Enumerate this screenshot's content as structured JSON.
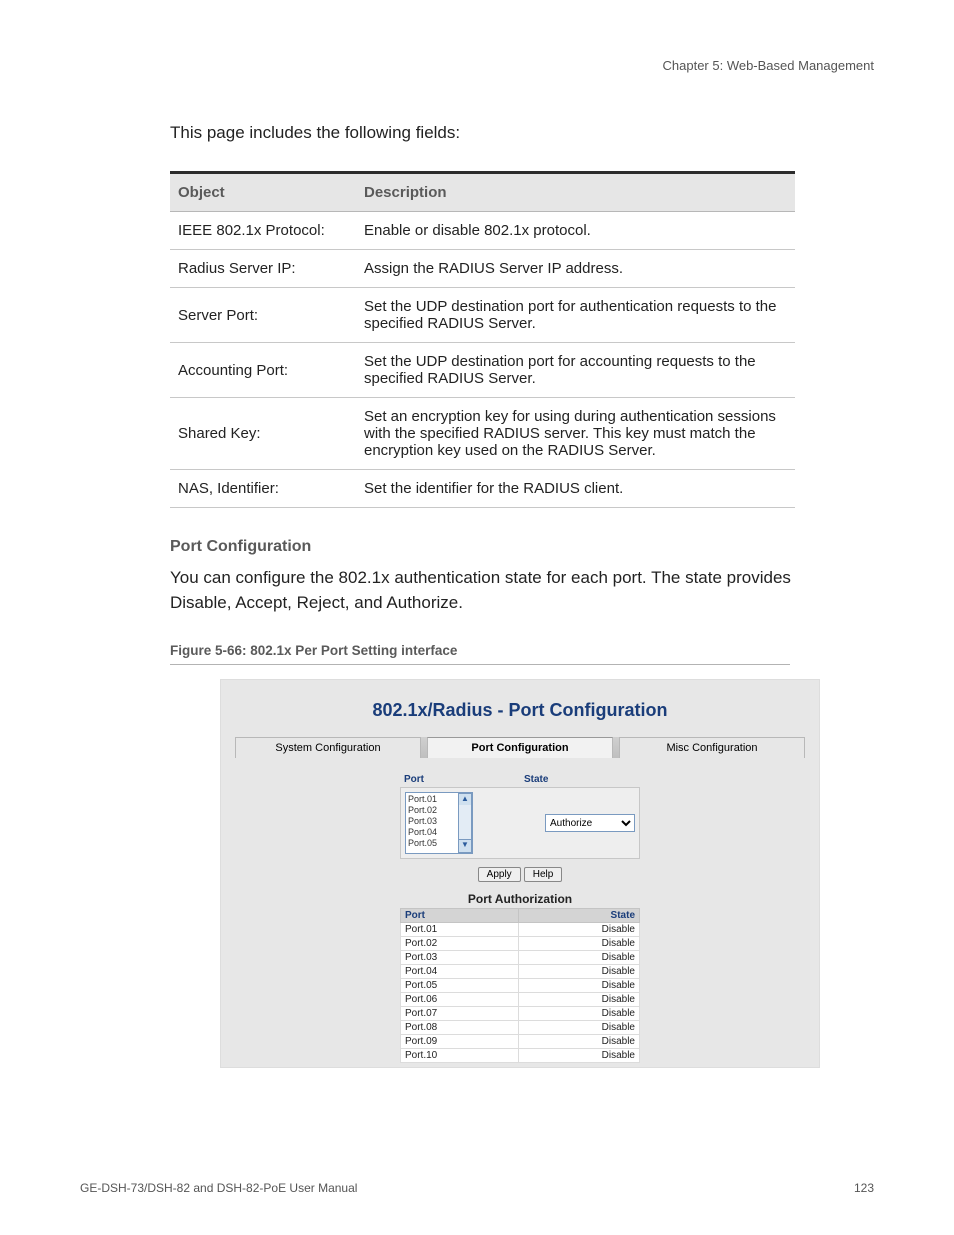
{
  "header": "Chapter 5: Web-Based Management",
  "intro": "This page includes the following fields:",
  "table": {
    "head": {
      "c1": "Object",
      "c2": "Description"
    },
    "rows": [
      {
        "obj": "IEEE 802.1x Protocol:",
        "desc": "Enable or disable 802.1x protocol."
      },
      {
        "obj": "Radius Server IP:",
        "desc": "Assign the RADIUS Server IP address."
      },
      {
        "obj": "Server Port:",
        "desc": "Set the UDP destination port for authentication requests to the specified RADIUS Server."
      },
      {
        "obj": "Accounting Port:",
        "desc": "Set the UDP destination port for accounting requests to the specified RADIUS Server."
      },
      {
        "obj": "Shared Key:",
        "desc": "Set an encryption key for using during authentication sessions with the specified RADIUS server. This key must match the encryption key used on the RADIUS Server."
      },
      {
        "obj": "NAS, Identifier:",
        "desc": "Set the identifier for the RADIUS client."
      }
    ]
  },
  "section_title": "Port Configuration",
  "section_body": "You can configure the 802.1x authentication state for each port. The state provides Disable, Accept, Reject, and Authorize.",
  "figure_caption": "Figure 5-66:  802.1x Per Port Setting interface",
  "gui": {
    "title": "802.1x/Radius - Port Configuration",
    "tabs": {
      "sys": "System Configuration",
      "port": "Port Configuration",
      "misc": "Misc Configuration"
    },
    "cfg_head": {
      "port": "Port",
      "state": "State"
    },
    "port_items": [
      "Port.01",
      "Port.02",
      "Port.03",
      "Port.04",
      "Port.05"
    ],
    "state_selected": "Authorize",
    "buttons": {
      "apply": "Apply",
      "help": "Help"
    },
    "auth_title": "Port Authorization",
    "auth_head": {
      "port": "Port",
      "state": "State"
    },
    "auth_rows": [
      {
        "port": "Port.01",
        "state": "Disable"
      },
      {
        "port": "Port.02",
        "state": "Disable"
      },
      {
        "port": "Port.03",
        "state": "Disable"
      },
      {
        "port": "Port.04",
        "state": "Disable"
      },
      {
        "port": "Port.05",
        "state": "Disable"
      },
      {
        "port": "Port.06",
        "state": "Disable"
      },
      {
        "port": "Port.07",
        "state": "Disable"
      },
      {
        "port": "Port.08",
        "state": "Disable"
      },
      {
        "port": "Port.09",
        "state": "Disable"
      },
      {
        "port": "Port.10",
        "state": "Disable"
      }
    ]
  },
  "footer": {
    "left": "GE-DSH-73/DSH-82 and DSH-82-PoE User Manual",
    "right": "123"
  }
}
